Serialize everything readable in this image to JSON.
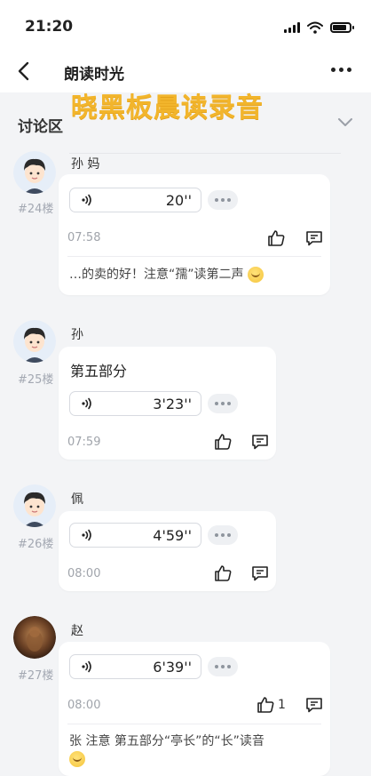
{
  "status": {
    "time": "21:20"
  },
  "nav": {
    "title": "朗读时光"
  },
  "watermark": "晓黑板晨读录音",
  "section": {
    "title": "讨论区"
  },
  "posts": [
    {
      "username": "孙     妈",
      "floor": "#24楼",
      "audio_duration": "20''",
      "time": "07:58",
      "reply": "…的卖的好！注意“孺”读第二声"
    },
    {
      "username": "孙",
      "floor": "#25楼",
      "text": "第五部分",
      "audio_duration": "3'23''",
      "time": "07:59"
    },
    {
      "username": "佩",
      "floor": "#26楼",
      "audio_duration": "4'59''",
      "time": "08:00"
    },
    {
      "username": "赵",
      "floor": "#27楼",
      "audio_duration": "6'39''",
      "time": "08:00",
      "like_count": "1",
      "reply": "张   注意 第五部分“亭长”的“长”读音"
    }
  ]
}
